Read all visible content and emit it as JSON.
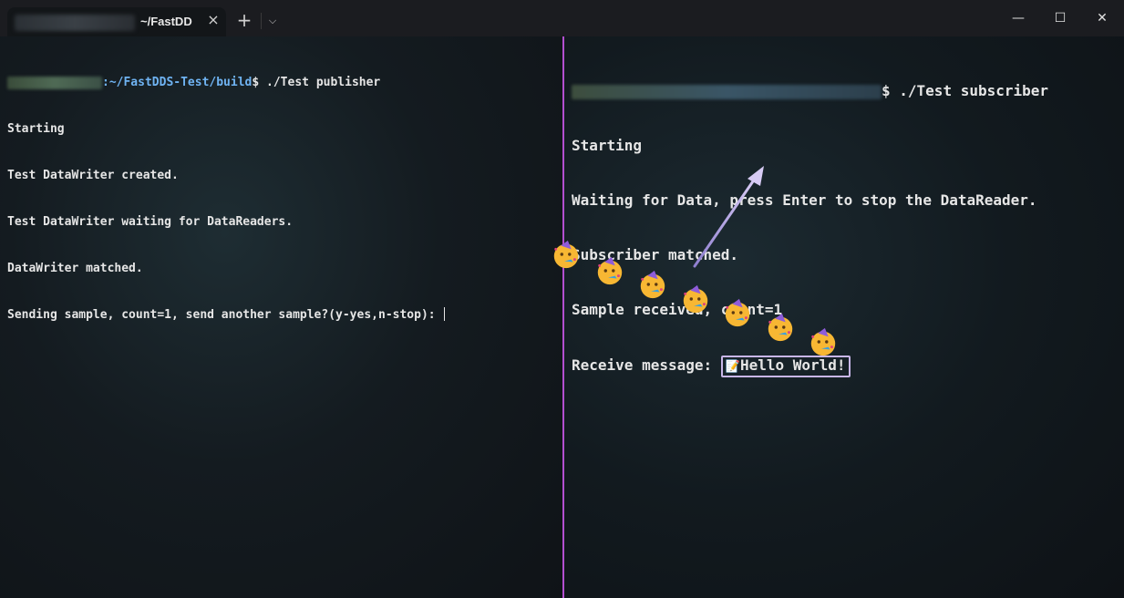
{
  "window": {
    "tab_title": "~/FastDD",
    "tab_close_icon": "×",
    "new_tab_icon": "+",
    "dropdown_icon": "⌵",
    "minimize_icon": "—",
    "maximize_icon": "☐",
    "close_icon": "✕"
  },
  "left_pane": {
    "prompt_path": ":~/FastDDS-Test/build",
    "prompt_symbol": "$",
    "command": " ./Test publisher",
    "output": [
      "Starting",
      "Test DataWriter created.",
      "Test DataWriter waiting for DataReaders.",
      "DataWriter matched.",
      "Sending sample, count=1, send another sample?(y-yes,n-stop): "
    ]
  },
  "right_pane": {
    "prompt_symbol": "$",
    "command": " ./Test subscriber",
    "output": [
      "Starting",
      "Waiting for Data, press Enter to stop the DataReader.",
      "Subscriber matched.",
      "Sample received, count=1"
    ],
    "receive_label": "Receive message: ",
    "message_emoji": "📝",
    "message_text": "Hello World!"
  },
  "colors": {
    "divider": "#b34fd0",
    "path": "#6fb3f2",
    "highlight_box": "#c8b6e8",
    "arrow": "#c8b6e8"
  },
  "decorations": {
    "party_icon_name": "partying-face-icon",
    "party_icon_count": 7
  }
}
